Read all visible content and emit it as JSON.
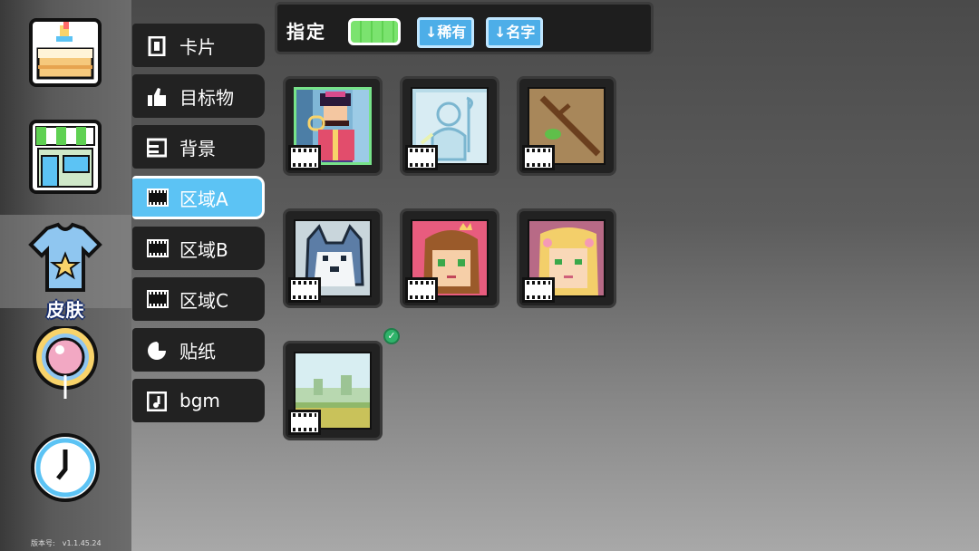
{
  "rail": {
    "items": [
      {
        "name": "cake-icon"
      },
      {
        "name": "shop-icon"
      },
      {
        "name": "shirt-icon",
        "label": "皮肤",
        "active": true
      },
      {
        "name": "balloon-icon"
      },
      {
        "name": "clock-icon"
      }
    ],
    "version_label": "版本号:",
    "version_value": "v1.1.45.24"
  },
  "categories": [
    {
      "label": "卡片",
      "icon": "card-icon"
    },
    {
      "label": "目标物",
      "icon": "thumbs-up-icon"
    },
    {
      "label": "背景",
      "icon": "background-icon"
    },
    {
      "label": "区域A",
      "icon": "film-icon",
      "active": true
    },
    {
      "label": "区域B",
      "icon": "film-icon"
    },
    {
      "label": "区域C",
      "icon": "film-icon"
    },
    {
      "label": "贴纸",
      "icon": "sticker-icon"
    },
    {
      "label": "bgm",
      "icon": "music-icon"
    }
  ],
  "toolbar": {
    "assign_label": "指定",
    "toggle_on": true,
    "sort_rarity": "↓稀有",
    "sort_name": "↓名字"
  },
  "items": [
    {
      "art": "pirate-captain-art",
      "selected": true
    },
    {
      "art": "ghost-sketch-art"
    },
    {
      "art": "stick-branch-art"
    },
    {
      "art": "husky-dog-art"
    },
    {
      "art": "princess-girl-art"
    },
    {
      "art": "blonde-girl-art"
    },
    {
      "art": "landscape-scene-art",
      "equipped": true
    }
  ],
  "colors": {
    "accent": "#5cc3f4",
    "toggle_green": "#7be36f",
    "selected_border": "#77e38a",
    "equipped_check": "#2fb36a"
  }
}
